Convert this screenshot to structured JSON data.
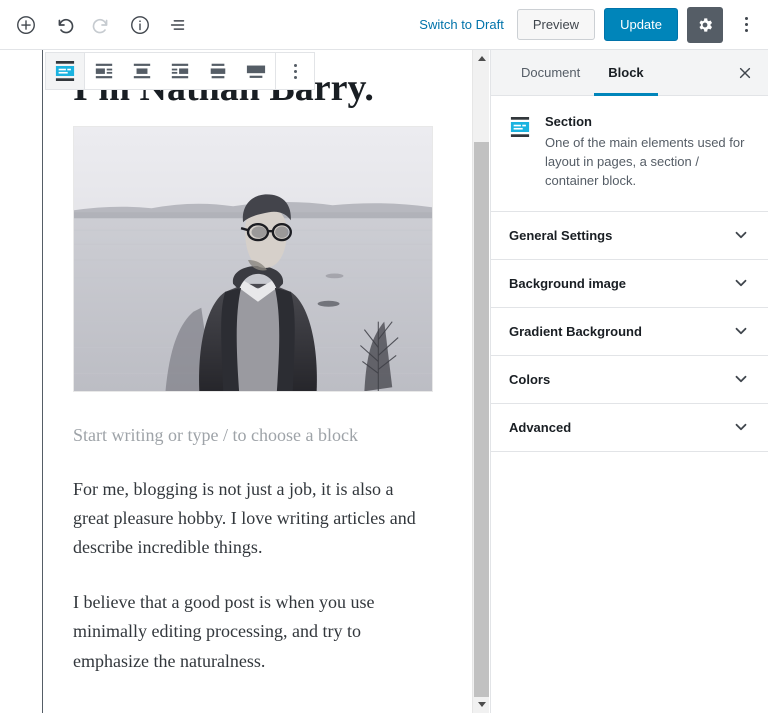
{
  "top_bar": {
    "left_icons": [
      {
        "name": "add-block-icon",
        "label": "Add block"
      },
      {
        "name": "undo-icon",
        "label": "Undo"
      },
      {
        "name": "redo-icon",
        "label": "Redo"
      },
      {
        "name": "content-info-icon",
        "label": "Content structure"
      },
      {
        "name": "block-navigation-icon",
        "label": "Block navigation"
      }
    ],
    "switch_to_draft_label": "Switch to Draft",
    "preview_label": "Preview",
    "update_label": "Update",
    "settings_icon": "gear-icon",
    "more_menu_icon": "vertical-ellipsis-icon"
  },
  "block_toolbar": {
    "selected_block_icon": "section-block-icon",
    "alignment_buttons": [
      "align-left-icon",
      "align-center-icon",
      "align-right-icon",
      "align-wide-icon",
      "align-full-icon"
    ],
    "more_options_icon": "vertical-ellipsis-icon"
  },
  "editor": {
    "heading": "I'm Nathan Barry.",
    "image_alt": "Black and white photo of a bearded man in glasses and a parka standing in front of a misty lake",
    "placeholder": "Start writing or type / to choose a block",
    "paragraphs": [
      "For me, blogging is not just a job, it is also a great pleasure hobby. I love writing articles and describe incredible things.",
      " I believe that a good post is when you use minimally editing processing, and try to emphasize the naturalness."
    ]
  },
  "sidebar": {
    "tabs": [
      {
        "label": "Document",
        "active": false
      },
      {
        "label": "Block",
        "active": true
      }
    ],
    "close_icon": "close-icon",
    "block_card": {
      "icon": "section-block-icon",
      "title": "Section",
      "description": "One of the main elements used for layout in pages, a section / container block."
    },
    "panels": [
      {
        "label": "General Settings",
        "expanded": false
      },
      {
        "label": "Background image",
        "expanded": false
      },
      {
        "label": "Gradient Background",
        "expanded": false
      },
      {
        "label": "Colors",
        "expanded": false
      },
      {
        "label": "Advanced",
        "expanded": false
      }
    ]
  },
  "colors": {
    "accent_blue": "#0085ba",
    "link_blue": "#0073aa",
    "section_icon_blue": "#1bb3e0",
    "text_dark": "#191e23",
    "text_muted": "#555d66",
    "placeholder_grey": "#9ea3a8",
    "border": "#e2e4e7",
    "gear_bg": "#555d66",
    "scrollbar_thumb": "#c1c1c1"
  }
}
